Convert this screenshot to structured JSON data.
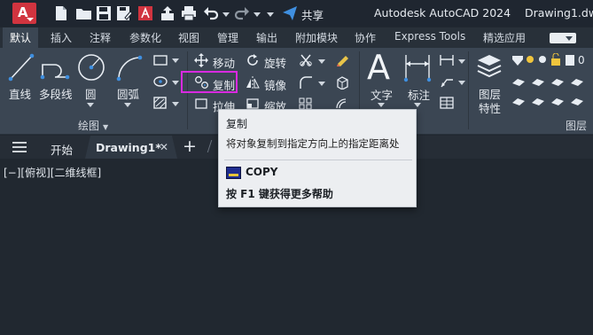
{
  "title_bar": {
    "app_logo": "A",
    "share": "共享",
    "app_name": "Autodesk AutoCAD 2024",
    "file_name": "Drawing1.dwg"
  },
  "ribbon_tabs": [
    "默认",
    "插入",
    "注释",
    "参数化",
    "视图",
    "管理",
    "输出",
    "附加模块",
    "协作",
    "Express Tools",
    "精选应用"
  ],
  "draw_panel": {
    "line": "直线",
    "polyline": "多段线",
    "circle": "圆",
    "arc": "圆弧",
    "title": "绘图"
  },
  "modify_panel": {
    "move": "移动",
    "rotate": "旋转",
    "copy": "复制",
    "mirror": "镜像",
    "stretch": "拉伸",
    "scale": "缩放"
  },
  "annotation_panel": {
    "text": "文字",
    "dimension": "标注",
    "text_glyph": "A"
  },
  "layers_panel": {
    "layer_properties_line1": "图层",
    "layer_properties_line2": "特性",
    "title": "图层",
    "layer_value": "0"
  },
  "file_tabs": {
    "start": "开始",
    "drawing": "Drawing1*",
    "close": "✕",
    "add": "+"
  },
  "viewport": {
    "label": "[−][俯视][二维线框]"
  },
  "tooltip": {
    "title": "复制",
    "description": "将对象复制到指定方向上的指定距离处",
    "command": "COPY",
    "help": "按 F1 键获得更多帮助"
  },
  "colors": {
    "highlight": "#d92ae0",
    "accent": "#3f8fe0",
    "logo": "#d1343f"
  }
}
